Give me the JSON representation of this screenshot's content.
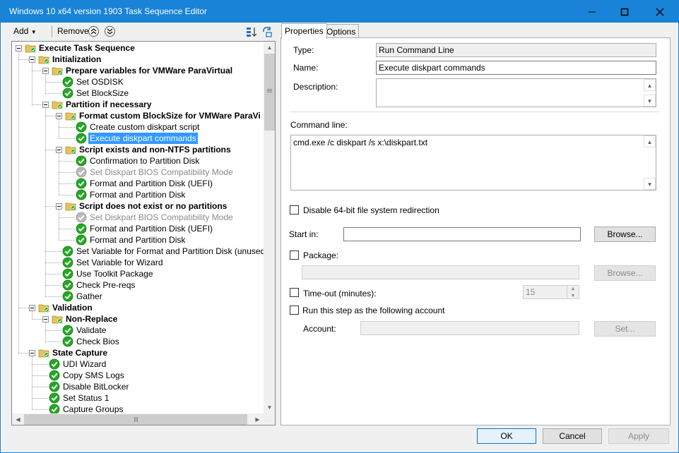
{
  "window": {
    "title": "Windows 10 x64 version 1903 Task Sequence Editor",
    "accent_color": "#1883d7"
  },
  "toolbar": {
    "add_label": "Add",
    "remove_label": "Remove"
  },
  "tree": {
    "items": [
      {
        "label": "Execute Task Sequence",
        "type": "group"
      },
      {
        "label": "Initialization",
        "type": "group"
      },
      {
        "label": "Prepare variables for VMWare ParaVirtual",
        "type": "group"
      },
      {
        "label": "Set OSDISK",
        "type": "step"
      },
      {
        "label": "Set BlockSize",
        "type": "step"
      },
      {
        "label": "Partition if necessary",
        "type": "group"
      },
      {
        "label": "Format custom BlockSize for VMWare ParaVi",
        "type": "group"
      },
      {
        "label": "Create custom diskpart script",
        "type": "step"
      },
      {
        "label": "Execute diskpart commands",
        "type": "step",
        "selected": true
      },
      {
        "label": "Script exists and non-NTFS partitions",
        "type": "group"
      },
      {
        "label": "Confirmation to Partition Disk",
        "type": "step"
      },
      {
        "label": "Set Diskpart BIOS Compatibility Mode",
        "type": "step",
        "disabled": true
      },
      {
        "label": "Format and Partition Disk (UEFI)",
        "type": "step"
      },
      {
        "label": "Format and Partition Disk",
        "type": "step"
      },
      {
        "label": "Script does not exist or no partitions",
        "type": "group"
      },
      {
        "label": "Set Diskpart BIOS Compatibility Mode",
        "type": "step",
        "disabled": true
      },
      {
        "label": "Format and Partition Disk (UEFI)",
        "type": "step"
      },
      {
        "label": "Format and Partition Disk",
        "type": "step"
      },
      {
        "label": "Set Variable for Format and Partition Disk (unused)",
        "type": "step"
      },
      {
        "label": "Set Variable for Wizard",
        "type": "step"
      },
      {
        "label": "Use Toolkit Package",
        "type": "step"
      },
      {
        "label": "Check Pre-reqs",
        "type": "step"
      },
      {
        "label": "Gather",
        "type": "step"
      },
      {
        "label": "Validation",
        "type": "group"
      },
      {
        "label": "Non-Replace",
        "type": "group"
      },
      {
        "label": "Validate",
        "type": "step"
      },
      {
        "label": "Check Bios",
        "type": "step"
      },
      {
        "label": "State Capture",
        "type": "group"
      },
      {
        "label": "UDI Wizard",
        "type": "step"
      },
      {
        "label": "Copy SMS Logs",
        "type": "step"
      },
      {
        "label": "Disable BitLocker",
        "type": "step"
      },
      {
        "label": "Set Status 1",
        "type": "step"
      },
      {
        "label": "Capture Groups",
        "type": "step"
      }
    ]
  },
  "tabs": [
    {
      "label": "Properties",
      "active": true
    },
    {
      "label": "Options",
      "active": false
    }
  ],
  "properties": {
    "type_label": "Type:",
    "type_value": "Run Command Line",
    "name_label": "Name:",
    "name_value": "Execute diskpart commands",
    "description_label": "Description:",
    "description_value": "",
    "command_line_label": "Command line:",
    "command_line_value": "cmd.exe /c diskpart /s x:\\diskpart.txt",
    "disable_redirection_label": "Disable 64-bit file system redirection",
    "disable_redirection_checked": false,
    "start_in_label": "Start in:",
    "start_in_value": "",
    "browse_label": "Browse...",
    "package_label": "Package:",
    "package_checked": false,
    "package_value": "",
    "package_browse_label": "Browse...",
    "timeout_label": "Time-out (minutes):",
    "timeout_checked": false,
    "timeout_value": "15",
    "run_as_label": "Run this step as the following account",
    "run_as_checked": false,
    "account_label": "Account:",
    "account_value": "",
    "set_label": "Set..."
  },
  "footer": {
    "ok_label": "OK",
    "cancel_label": "Cancel",
    "apply_label": "Apply"
  }
}
